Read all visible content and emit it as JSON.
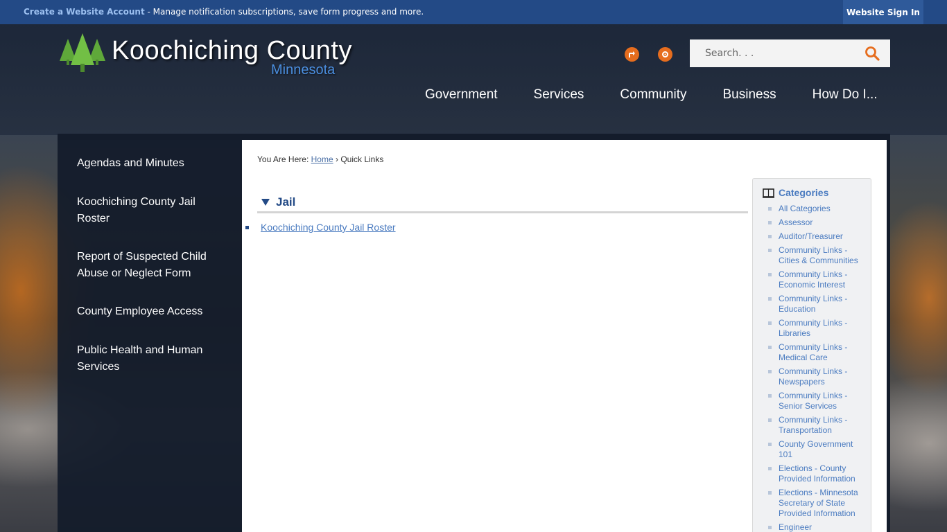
{
  "topbar": {
    "create_account": "Create a Website Account",
    "message": " - Manage notification subscriptions, save form progress and more.",
    "signin": "Website Sign In"
  },
  "brand": {
    "name": "Koochiching County",
    "state": "Minnesota"
  },
  "icons": {
    "share": "share-icon",
    "settings": "gear-icon",
    "search": "search-icon"
  },
  "search": {
    "placeholder": "Search. . ."
  },
  "nav": [
    "Government",
    "Services",
    "Community",
    "Business",
    "How Do I..."
  ],
  "sidebar": [
    "Agendas and Minutes",
    "Koochiching County Jail Roster",
    "Report of Suspected Child Abuse or Neglect Form",
    "County Employee Access",
    "Public Health and Human Services"
  ],
  "breadcrumb": {
    "prefix": "You Are Here:",
    "home": "Home",
    "current": "Quick Links"
  },
  "section": {
    "title": "Jail",
    "items": [
      "Koochiching County Jail Roster"
    ]
  },
  "categories": {
    "title": "Categories",
    "items": [
      "All Categories",
      "Assessor",
      "Auditor/Treasurer",
      "Community Links - Cities & Communities",
      "Community Links - Economic Interest",
      "Community Links - Education",
      "Community Links - Libraries",
      "Community Links - Medical Care",
      "Community Links - Newspapers",
      "Community Links - Senior Services",
      "Community Links - Transportation",
      "County Government 101",
      "Elections - County Provided Information",
      "Elections - Minnesota Secretary of State Provided Information",
      "Engineer"
    ]
  },
  "colors": {
    "topbar": "#234a86",
    "accent_orange": "#e66d1e",
    "link_blue": "#4a7bc0",
    "brand_blue": "#4b8fe0"
  }
}
